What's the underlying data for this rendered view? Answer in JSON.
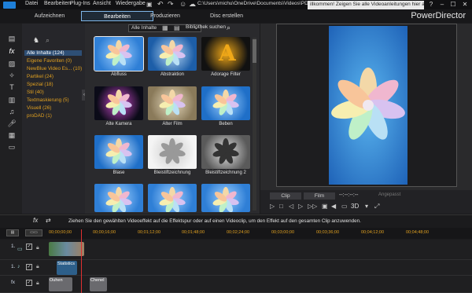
{
  "menu": [
    "Datei",
    "Bearbeiten",
    "Plug-Ins",
    "Ansicht",
    "Wiedergabe"
  ],
  "title_path": "C:\\Users\\michu\\OneDrive\\Documents\\Videos\\PD-Test",
  "notification": "illkommen! Zeigen Sie alle Videoanleitungen hier an!",
  "window_buttons": [
    "?",
    "–",
    "☐",
    "✕"
  ],
  "mode_tabs": [
    {
      "label": "Aufzeichnen",
      "active": false
    },
    {
      "label": "Bearbeiten",
      "active": true
    },
    {
      "label": "Produzieren",
      "active": false
    },
    {
      "label": "Disc erstellen",
      "active": false
    }
  ],
  "brand": "PowerDirector",
  "filter": {
    "value": "Alle Inhalte",
    "library_search": "Bibliothek suchen"
  },
  "categories": [
    "Alle Inhalte (124)",
    "Eigene Favoriten  (0)",
    "NewBlue Video Es...  (10)",
    "Partikel  (24)",
    "Spezial  (18)",
    "Stil  (40)",
    "Textmaskierung  (5)",
    "Visuell  (26)",
    "proDAD  (1)"
  ],
  "effects": [
    {
      "label": "Abfluss"
    },
    {
      "label": "Abstraktion"
    },
    {
      "label": "Adorage Filter"
    },
    {
      "label": "Alte Kamera"
    },
    {
      "label": "Alter Film"
    },
    {
      "label": "Beben"
    },
    {
      "label": "Blase"
    },
    {
      "label": "Bleistiftzeichnung"
    },
    {
      "label": "Bleistiftzeichnung 2"
    },
    {
      "label": ""
    },
    {
      "label": ""
    },
    {
      "label": ""
    }
  ],
  "preview": {
    "clip_btn": "Clip",
    "film_btn": "Film",
    "timecode": "--:--:--:--",
    "aspect": "Angepasst",
    "mode3d": "3D"
  },
  "hint": "Ziehen Sie den gewählten Videoeffekt auf die Effektspur oder auf einen Videoclip, um den Effekt auf den gesamten Clip anzuwenden.",
  "timeline": {
    "ticks": [
      "00;00;00;00",
      "00;00;16;00",
      "00;01;12;00",
      "00;01;48;00",
      "00;02;24;00",
      "00;03;00;00",
      "00;03;36;00",
      "00;04;12;00",
      "00;04;48;00"
    ],
    "tracks": [
      {
        "label": "1."
      },
      {
        "label": "1."
      },
      {
        "label": "fx"
      }
    ],
    "clips": [
      "Statistics",
      "Ouhen",
      "Chenel"
    ]
  },
  "colors": {
    "accent": "#3a8ee6",
    "category_text": "#e0a020",
    "selection": "#2e4f75"
  }
}
